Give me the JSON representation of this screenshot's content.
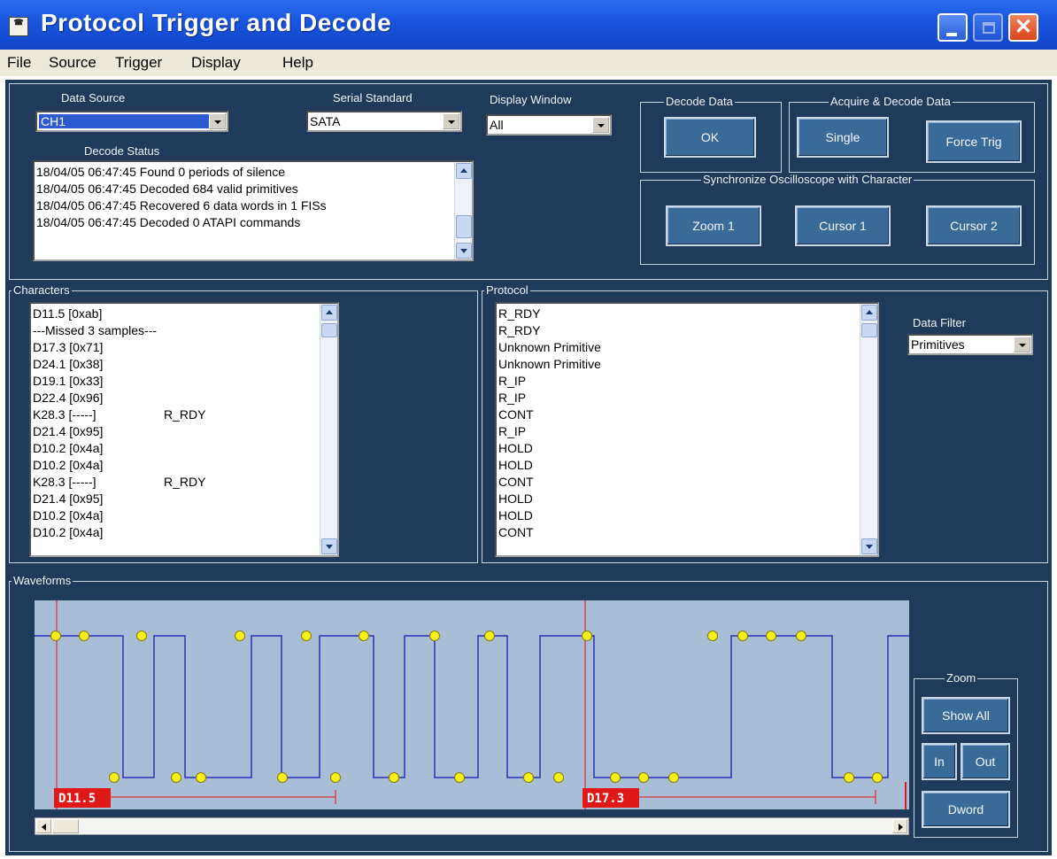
{
  "window": {
    "title": "Protocol Trigger and Decode",
    "icon_text": "☎"
  },
  "menu": [
    {
      "label": "File"
    },
    {
      "label": "Source"
    },
    {
      "label": "Trigger"
    },
    {
      "label": "Display"
    },
    {
      "label": "Help"
    }
  ],
  "top": {
    "data_source": {
      "label": "Data Source",
      "value": "CH1"
    },
    "serial_standard": {
      "label": "Serial Standard",
      "value": "SATA"
    },
    "display_window": {
      "label": "Display Window",
      "value": "All"
    },
    "decode_status": {
      "label": "Decode Status",
      "lines": [
        "18/04/05 06:47:45 Found 0 periods of silence",
        "18/04/05 06:47:45 Decoded 684 valid primitives",
        "18/04/05 06:47:45 Recovered 6 data words in 1 FISs",
        "18/04/05 06:47:45 Decoded 0 ATAPI commands"
      ]
    },
    "decode_data": {
      "label": "Decode Data",
      "ok": "OK"
    },
    "acquire": {
      "label": "Acquire & Decode Data",
      "single": "Single",
      "force_trig": "Force Trig"
    },
    "sync": {
      "label": "Synchronize Oscilloscope with Character",
      "zoom1": "Zoom 1",
      "cursor1": "Cursor 1",
      "cursor2": "Cursor 2"
    }
  },
  "characters": {
    "label": "Characters",
    "rows": [
      {
        "text": "D11.5  [0xab]",
        "tag": ""
      },
      {
        "text": "---Missed 3 samples---",
        "tag": ""
      },
      {
        "text": "D17.3  [0x71]",
        "tag": ""
      },
      {
        "text": "D24.1  [0x38]",
        "tag": ""
      },
      {
        "text": "D19.1  [0x33]",
        "tag": ""
      },
      {
        "text": "D22.4  [0x96]",
        "tag": ""
      },
      {
        "text": "K28.3  [-----]",
        "tag": "R_RDY"
      },
      {
        "text": "D21.4  [0x95]",
        "tag": ""
      },
      {
        "text": "D10.2  [0x4a]",
        "tag": ""
      },
      {
        "text": "D10.2  [0x4a]",
        "tag": ""
      },
      {
        "text": "K28.3  [-----]",
        "tag": "R_RDY"
      },
      {
        "text": "D21.4  [0x95]",
        "tag": ""
      },
      {
        "text": "D10.2  [0x4a]",
        "tag": ""
      },
      {
        "text": "D10.2  [0x4a]",
        "tag": ""
      }
    ]
  },
  "protocol": {
    "label": "Protocol",
    "rows": [
      "R_RDY",
      "R_RDY",
      "Unknown Primitive",
      "Unknown Primitive",
      "R_IP",
      "R_IP",
      "CONT",
      "R_IP",
      "HOLD",
      "HOLD",
      "CONT",
      "HOLD",
      "HOLD",
      "CONT"
    ],
    "data_filter": {
      "label": "Data Filter",
      "value": "Primitives"
    }
  },
  "waveforms": {
    "label": "Waveforms",
    "markers": [
      "D11.5",
      "D17.3"
    ],
    "trace_color": "#2b2fb8",
    "sample_color": "#f6ef1a",
    "marker_color": "#e01818"
  },
  "zoom": {
    "label": "Zoom",
    "show_all": "Show All",
    "in": "In",
    "out": "Out",
    "dword": "Dword"
  }
}
